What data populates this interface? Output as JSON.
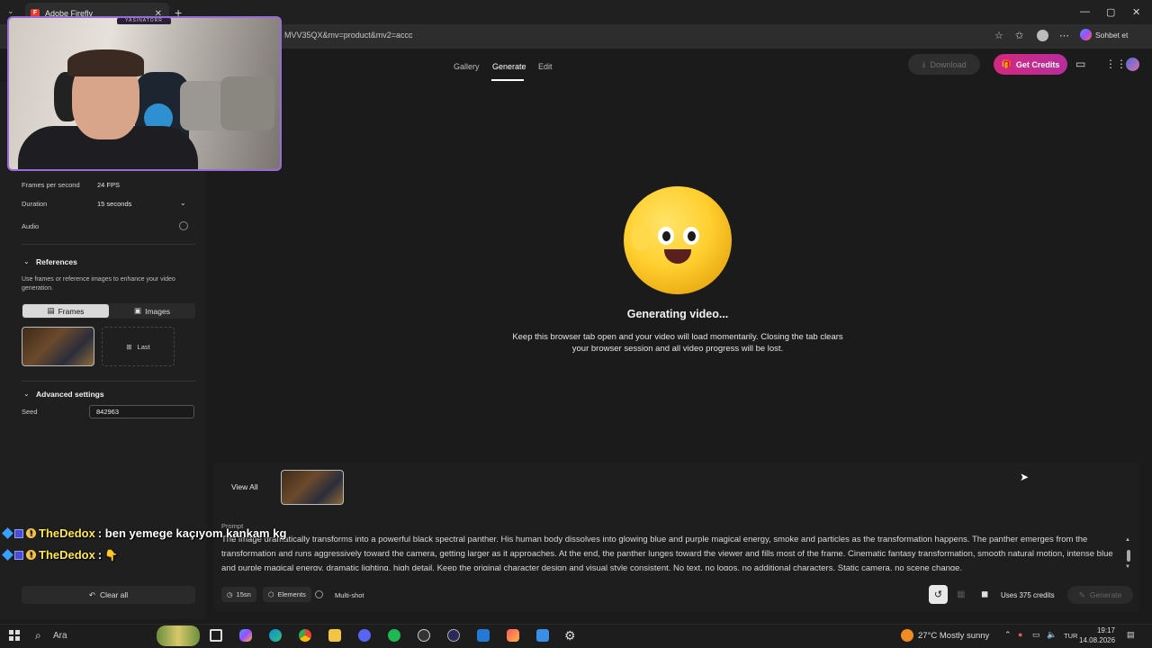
{
  "browser": {
    "tab_title": "Adobe Firefly",
    "tab_close": "✕",
    "new_tab": "+",
    "url": "MVV35QX&mv=product&mv2=accc",
    "copilot_label": "Sohbet et",
    "window_controls": [
      "—",
      "▢",
      "✕"
    ]
  },
  "header": {
    "nav": [
      "Gallery",
      "Generate",
      "Edit"
    ],
    "download_label": "Download",
    "credits_label": "Get Credits"
  },
  "sidebar": {
    "fps_label": "Frames per second",
    "fps_value": "24 FPS",
    "duration_label": "Duration",
    "duration_value": "15 seconds",
    "audio_label": "Audio",
    "audio_on": false,
    "references_title": "References",
    "references_desc": "Use frames or reference images to enhance your video generation.",
    "tab_frames": "Frames",
    "tab_images": "Images",
    "last_frame_label": "Last",
    "advanced_title": "Advanced settings",
    "seed_label": "Seed",
    "seed_value": "842963",
    "clear_label": "Clear all"
  },
  "webcam": {
    "name_tag": "YASINATORR"
  },
  "main": {
    "status_title": "Generating video...",
    "status_desc": "Keep this browser tab open and your video will load momentarily. Closing the tab clears your browser session and all video progress will be lost."
  },
  "prompt": {
    "view_all": "View All",
    "label": "Prompt",
    "text": "The image dramatically transforms into a powerful black spectral panther. His human body dissolves into glowing blue and purple magical energy, smoke and particles as the transformation happens. The panther emerges from the transformation and runs aggressively toward the camera, getting larger as it approaches. At the end, the panther lunges toward the viewer and fills most of the frame. Cinematic fantasy transformation, smooth natural motion, intense blue and purple magical energy, dramatic lighting, high detail. Keep the original character design and visual style consistent. No text, no logos, no additional characters. Static camera, no scene change.",
    "duration_chip": "15sn",
    "elements_chip": "Elements",
    "multishot_label": "Multi-shot",
    "credits_text": "Uses 375 credits",
    "generate_label": "Generate"
  },
  "chat": [
    {
      "user": "TheDedox",
      "message": ": ben yemege kaçıyom kankam kg"
    },
    {
      "user": "TheDedox",
      "message": ":"
    }
  ],
  "taskbar": {
    "search_placeholder": "Ara",
    "weather": "27°C  Mostly sunny",
    "language": "TUR",
    "time": "19:17",
    "date": "14.08.2026"
  },
  "colors": {
    "accent_credits": "#d3287f",
    "webcam_border": "#9a6ad8",
    "background": "#1b1b1b"
  }
}
